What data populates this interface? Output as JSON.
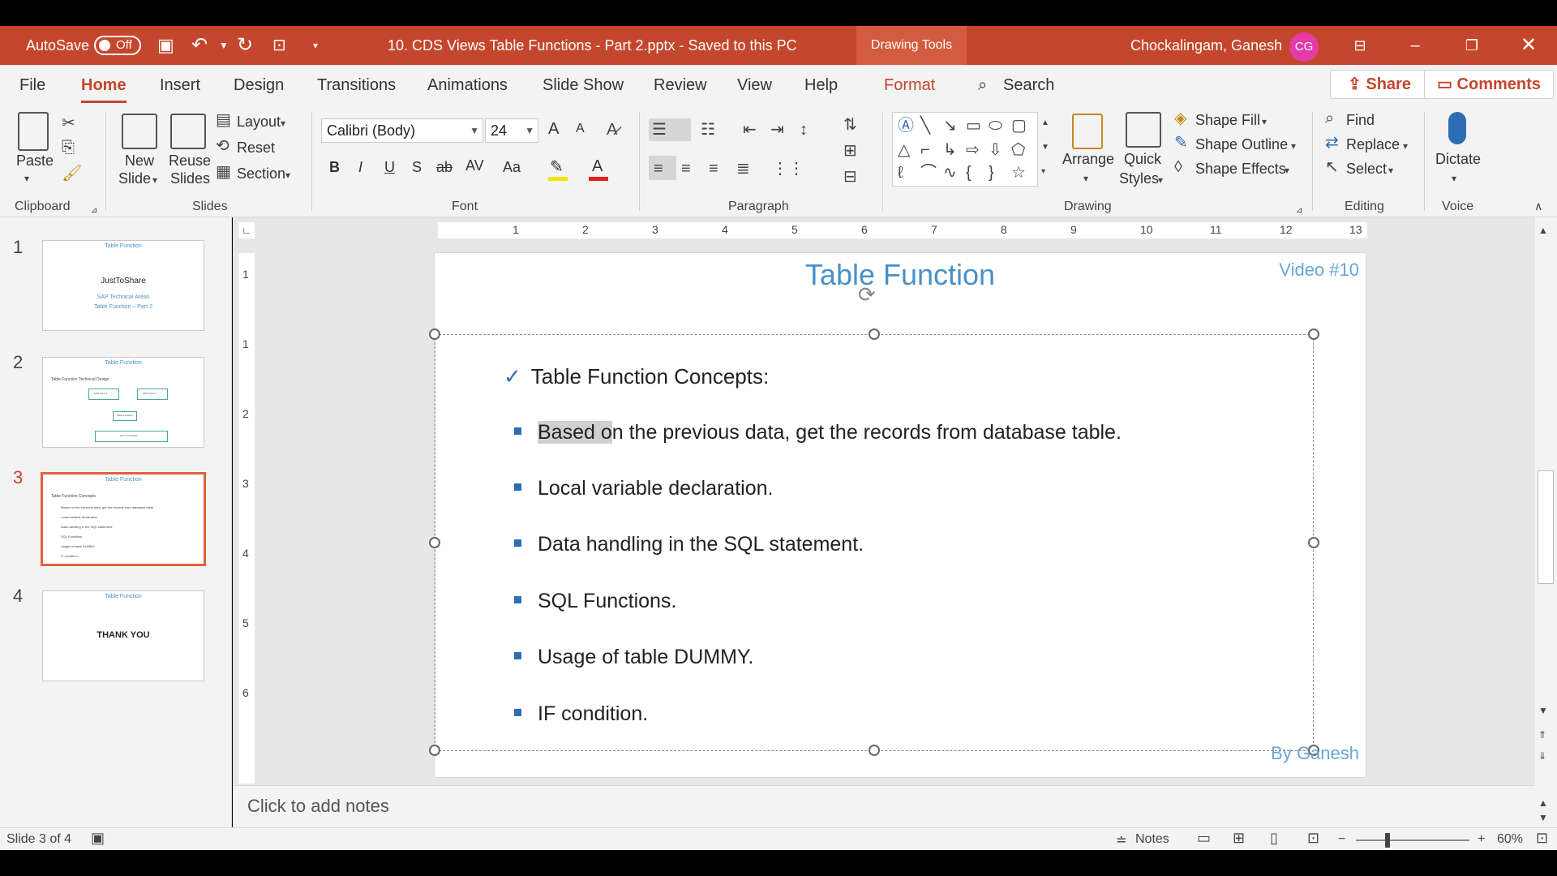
{
  "titlebar": {
    "autosave_label": "AutoSave",
    "autosave_state": "Off",
    "document_title": "10. CDS Views Table Functions - Part 2.pptx  -  Saved to this PC",
    "context_tab": "Drawing Tools",
    "user_name": "Chockalingam, Ganesh",
    "user_initials": "CG",
    "colors": {
      "bar": "#c4462c",
      "avatar": "#e43ba6"
    }
  },
  "tabs": {
    "items": [
      "File",
      "Home",
      "Insert",
      "Design",
      "Transitions",
      "Animations",
      "Slide Show",
      "Review",
      "View",
      "Help",
      "Format"
    ],
    "active": "Home",
    "search": "Search",
    "share": "Share",
    "comments": "Comments"
  },
  "ribbon": {
    "clipboard": {
      "label": "Clipboard",
      "paste": "Paste"
    },
    "slides": {
      "label": "Slides",
      "new_slide_1": "New",
      "new_slide_2": "Slide",
      "reuse_1": "Reuse",
      "reuse_2": "Slides",
      "layout": "Layout",
      "reset": "Reset",
      "section": "Section"
    },
    "font": {
      "label": "Font",
      "family": "Calibri (Body)",
      "size": "24",
      "bold": "B",
      "italic": "I",
      "underline": "U",
      "shadow": "S",
      "strike": "ab",
      "spacing": "AV",
      "case": "Aa",
      "grow": "A",
      "shrink": "A",
      "font_color": "A"
    },
    "paragraph": {
      "label": "Paragraph"
    },
    "drawing": {
      "label": "Drawing",
      "arrange": "Arrange",
      "quick_1": "Quick",
      "quick_2": "Styles",
      "shape_fill": "Shape Fill",
      "shape_outline": "Shape Outline",
      "shape_effects": "Shape Effects"
    },
    "editing": {
      "label": "Editing",
      "find": "Find",
      "replace": "Replace",
      "select": "Select"
    },
    "voice": {
      "label": "Voice",
      "dictate": "Dictate"
    }
  },
  "thumbnails": [
    {
      "num": "1",
      "title": "Table Function",
      "lines": [
        "JustToShare",
        "SAP Technical Areas",
        "Table Function – Part 2"
      ]
    },
    {
      "num": "2",
      "title": "Table Function",
      "lines": [
        "Table Function Technical Design",
        "CDS View 1",
        "CDS View 2",
        "Table Function",
        "Use on Interface"
      ]
    },
    {
      "num": "3",
      "title": "Table Function",
      "lines": [
        "Table Function Concepts:",
        "Based on the previous data, get the records from database table.",
        "Local variable declaration.",
        "Data handling in the SQL statement.",
        "SQL Functions.",
        "Usage of table DUMMY.",
        "IF condition."
      ]
    },
    {
      "num": "4",
      "title": "Table Function",
      "lines": [
        "THANK YOU"
      ]
    }
  ],
  "ruler": {
    "h": [
      "1",
      "2",
      "3",
      "4",
      "5",
      "6",
      "7",
      "8",
      "9",
      "10",
      "11",
      "12",
      "13"
    ],
    "v": [
      "1",
      "1",
      "2",
      "3",
      "4",
      "5",
      "6"
    ]
  },
  "slide": {
    "title": "Table Function",
    "video": "Video #10",
    "byline": "By Ganesh",
    "heading": "Table Function Concepts:",
    "bullet_1_highlight": "Based o",
    "bullet_1_rest": "n the previous data, get the records from database table.",
    "bullets": [
      "Local variable declaration.",
      "Data handling in the SQL statement.",
      "SQL Functions.",
      "Usage of table DUMMY.",
      "IF condition."
    ]
  },
  "notes": {
    "placeholder": "Click to add notes"
  },
  "status": {
    "slide_counter": "Slide 3 of 4",
    "notes": "Notes",
    "zoom": "60%",
    "zoom_fraction": 0.6
  }
}
